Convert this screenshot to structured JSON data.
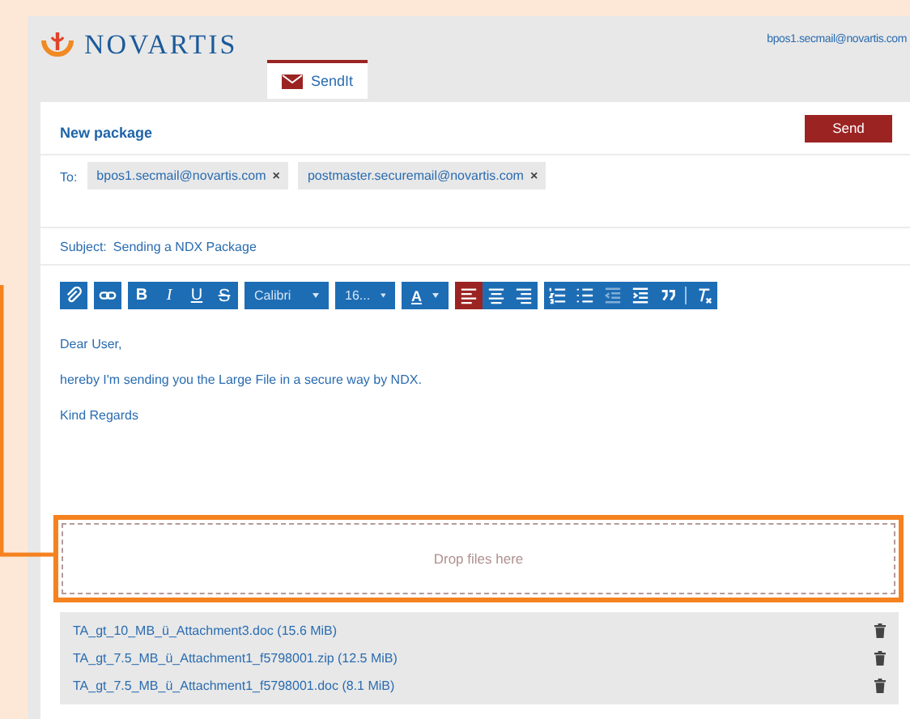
{
  "header": {
    "logo_text": "NOVARTIS",
    "user": "bpos1.secmail@novartis.com"
  },
  "tabs": [
    {
      "label": "SendIt",
      "selected": true
    }
  ],
  "compose": {
    "title": "New package",
    "send_button": "Send",
    "to_label": "To:",
    "recipients": [
      {
        "address": "bpos1.secmail@novartis.com",
        "remove": "×"
      },
      {
        "address": "postmaster.securemail@novartis.com",
        "remove": "×"
      }
    ],
    "subject_label": "Subject:",
    "subject": "Sending a NDX Package"
  },
  "toolbar": {
    "groups": [
      [
        {
          "kind": "attach"
        }
      ],
      [
        {
          "kind": "link"
        }
      ],
      [
        {
          "kind": "bold",
          "label": "B"
        },
        {
          "kind": "italic",
          "label": "I"
        },
        {
          "kind": "underline",
          "label": "U"
        },
        {
          "kind": "strike",
          "label": "S"
        }
      ],
      [
        {
          "kind": "font",
          "label": "Calibri"
        }
      ],
      [
        {
          "kind": "size",
          "label": "16..."
        }
      ],
      [
        {
          "kind": "color",
          "label": "A"
        }
      ],
      [
        {
          "kind": "align-left",
          "selected": true
        },
        {
          "kind": "align-center",
          "selected": false
        },
        {
          "kind": "align-right",
          "selected": false
        }
      ],
      [
        {
          "kind": "ordered-list",
          "disabled": false
        },
        {
          "kind": "bullet-list",
          "disabled": false
        },
        {
          "kind": "outdent",
          "disabled": true
        },
        {
          "kind": "indent",
          "disabled": false
        },
        {
          "kind": "quote",
          "disabled": false
        },
        {
          "kind": "separator"
        },
        {
          "kind": "clear-format",
          "disabled": false
        }
      ]
    ]
  },
  "body": [
    "Dear User,",
    "hereby I'm sending you the Large File in a secure way by NDX.",
    "Kind Regards"
  ],
  "dropzone": {
    "label": "Drop files here",
    "highlighted": true
  },
  "attachments": [
    {
      "name": "TA_gt_10_MB_ü_Attachment3.doc (15.6 MiB)"
    },
    {
      "name": "TA_gt_7.5_MB_ü_Attachment1_f5798001.zip (12.5 MiB)"
    },
    {
      "name": "TA_gt_7.5_MB_ü_Attachment1_f5798001.doc (8.1 MiB)"
    }
  ]
}
